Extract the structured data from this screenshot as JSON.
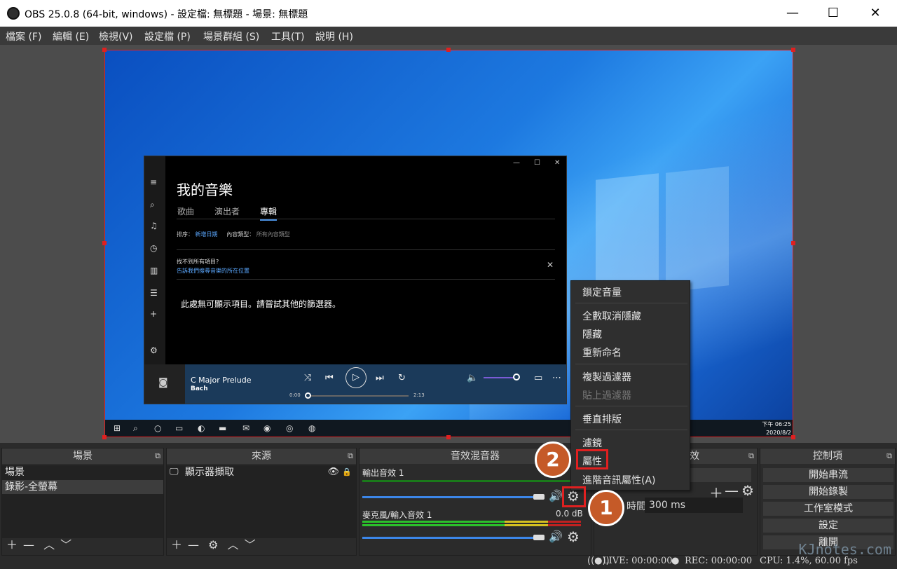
{
  "window": {
    "title": "OBS 25.0.8 (64-bit, windows) - 設定檔: 無標題 - 場景: 無標題",
    "minimize": "—",
    "maximize": "☐",
    "close": "✕"
  },
  "menu": [
    "檔案 (F)",
    "編輯 (E)",
    "檢視(V)",
    "設定檔 (P)",
    "場景群組 (S)",
    "工具(T)",
    "說明 (H)"
  ],
  "music_app": {
    "title": "我的音樂",
    "tabs": [
      "歌曲",
      "演出者",
      "專輯"
    ],
    "sort_label": "排序：",
    "sort_value": "新增日期",
    "type_label": "內容類型：",
    "type_value": "所有內容類型",
    "notice_title": "找不到所有項目?",
    "notice_link": "告訴我們搜尋音樂的所在位置",
    "empty_text": "此處無可顯示項目。請嘗試其他的篩選器。",
    "song": "C Major Prelude",
    "artist": "Bach",
    "time_start": "0:00",
    "time_end": "2:13"
  },
  "taskbar": {
    "time": "下午 06:25",
    "date": "2020/8/2"
  },
  "context_menu": [
    {
      "label": "鎖定音量",
      "disabled": false
    },
    {
      "label": "全數取消隱藏",
      "disabled": false
    },
    {
      "label": "隱藏",
      "disabled": false
    },
    {
      "label": "重新命名",
      "disabled": false
    },
    {
      "label": "複製過濾器",
      "disabled": false
    },
    {
      "label": "貼上過濾器",
      "disabled": true
    },
    {
      "label": "垂直排版",
      "disabled": false
    },
    {
      "label": "濾鏡",
      "disabled": false
    },
    {
      "label": "屬性",
      "disabled": false
    },
    {
      "label": "進階音訊屬性(A)",
      "disabled": false
    }
  ],
  "badges": [
    "2",
    "1"
  ],
  "docks": {
    "scenes": {
      "header": "場景",
      "items": [
        "場景",
        "錄影-全螢幕"
      ]
    },
    "sources": {
      "header": "來源",
      "items": [
        "顯示器擷取"
      ]
    },
    "mixer": {
      "header": "音效混音器",
      "tracks": [
        {
          "name": "輸出音效 1",
          "level": ""
        },
        {
          "name": "麥克風/輸入音效 1",
          "level": "0.0 dB"
        }
      ]
    },
    "transitions": {
      "header": "效",
      "duration_label": "時間",
      "duration_value": "300 ms"
    },
    "controls": {
      "header": "控制項",
      "buttons": [
        "開始串流",
        "開始錄製",
        "工作室模式",
        "設定",
        "離開"
      ]
    }
  },
  "status": {
    "live": "LIVE: 00:00:00",
    "rec": "REC: 00:00:00",
    "cpu": "CPU: 1.4%, 60.00 fps"
  },
  "watermark": "KJnotes.com"
}
